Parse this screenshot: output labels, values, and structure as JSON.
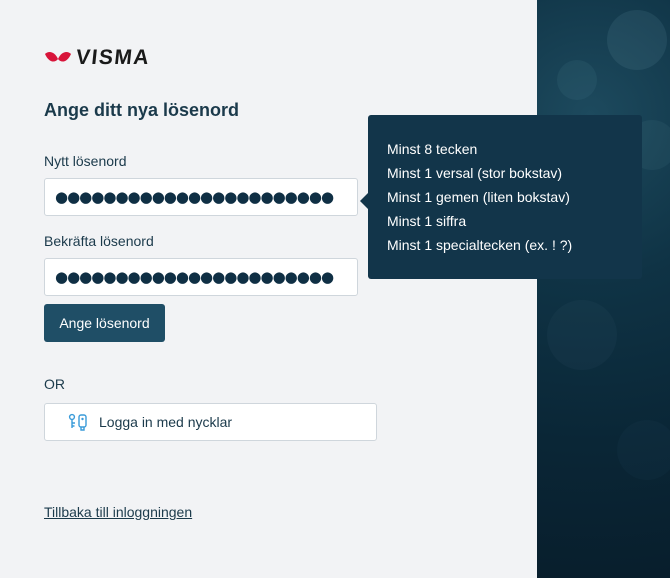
{
  "brand": {
    "name": "VISMA",
    "accent_color": "#d8143a"
  },
  "heading": "Ange ditt nya lösenord",
  "new_password": {
    "label": "Nytt lösenord",
    "value": "●●●●●●●●●●●●●●●●●●●●●●●"
  },
  "confirm_password": {
    "label": "Bekräfta lösenord",
    "value": "●●●●●●●●●●●●●●●●●●●●●●●"
  },
  "submit_label": "Ange lösenord",
  "or_label": "OR",
  "passkey_label": "Logga in med nycklar",
  "back_link": "Tillbaka till inloggningen",
  "requirements": [
    "Minst 8 tecken",
    "Minst 1 versal (stor bokstav)",
    "Minst 1 gemen (liten bokstav)",
    "Minst 1 siffra",
    "Minst 1 specialtecken (ex. ! ?)"
  ],
  "colors": {
    "primary": "#1f4e66",
    "tooltip_bg": "#12354a",
    "background": "#f2f3f5"
  }
}
